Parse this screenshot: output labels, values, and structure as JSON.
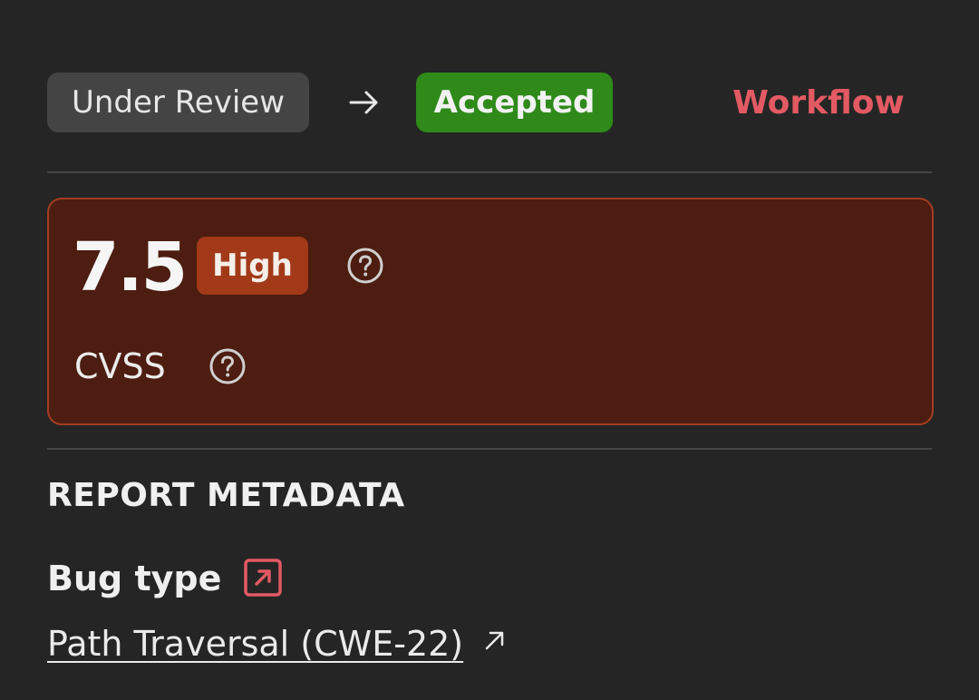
{
  "workflow": {
    "from_status": "Under Review",
    "to_status": "Accepted",
    "link_label": "Workflow",
    "arrow_icon": "arrow-right-icon"
  },
  "severity": {
    "score": "7.5",
    "level": "High",
    "metric_label": "CVSS",
    "help_icon": "question-circle-icon"
  },
  "metadata": {
    "heading": "REPORT METADATA",
    "bug_type_label": "Bug type",
    "bug_type_value": "Path Traversal (CWE-22)",
    "external_box_icon": "external-link-box-icon",
    "external_arrow_icon": "external-arrow-icon"
  },
  "colors": {
    "background": "#252525",
    "accepted_green": "#2f8a1a",
    "workflow_red": "#e35a63",
    "severity_card_bg": "#4c1d10",
    "severity_card_border": "#a33d22",
    "high_badge": "#a23a1a"
  }
}
